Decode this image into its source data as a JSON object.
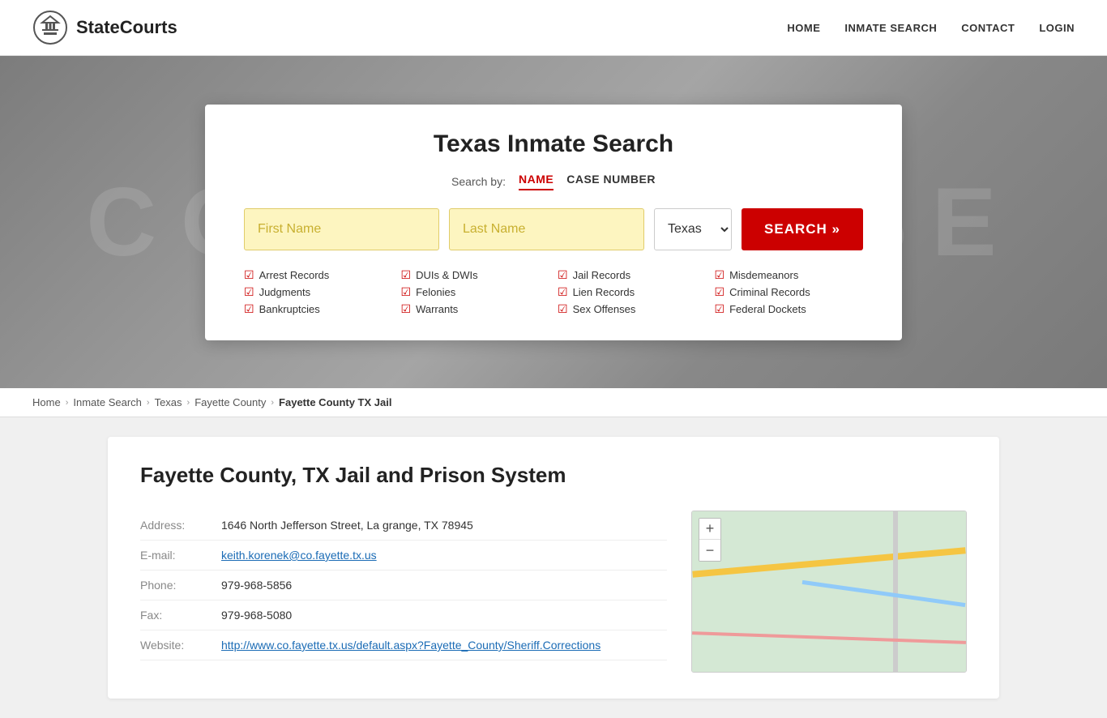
{
  "header": {
    "logo_text": "StateCourts",
    "nav": {
      "home": "HOME",
      "inmate_search": "INMATE SEARCH",
      "contact": "CONTACT",
      "login": "LOGIN"
    }
  },
  "hero": {
    "bg_text": "COURTHOUSE"
  },
  "search_card": {
    "title": "Texas Inmate Search",
    "search_by_label": "Search by:",
    "tab_name": "NAME",
    "tab_case_number": "CASE NUMBER",
    "first_name_placeholder": "First Name",
    "last_name_placeholder": "Last Name",
    "state_value": "Texas",
    "search_button": "SEARCH »",
    "checkboxes": [
      {
        "label": "Arrest Records"
      },
      {
        "label": "DUIs & DWIs"
      },
      {
        "label": "Jail Records"
      },
      {
        "label": "Misdemeanors"
      },
      {
        "label": "Judgments"
      },
      {
        "label": "Felonies"
      },
      {
        "label": "Lien Records"
      },
      {
        "label": "Criminal Records"
      },
      {
        "label": "Bankruptcies"
      },
      {
        "label": "Warrants"
      },
      {
        "label": "Sex Offenses"
      },
      {
        "label": "Federal Dockets"
      }
    ]
  },
  "breadcrumb": {
    "items": [
      {
        "label": "Home",
        "link": true
      },
      {
        "label": "Inmate Search",
        "link": true
      },
      {
        "label": "Texas",
        "link": true
      },
      {
        "label": "Fayette County",
        "link": true
      },
      {
        "label": "Fayette County TX Jail",
        "link": false
      }
    ]
  },
  "content": {
    "title": "Fayette County, TX Jail and Prison System",
    "address_label": "Address:",
    "address_value": "1646 North Jefferson Street, La grange, TX 78945",
    "email_label": "E-mail:",
    "email_value": "keith.korenek@co.fayette.tx.us",
    "phone_label": "Phone:",
    "phone_value": "979-968-5856",
    "fax_label": "Fax:",
    "fax_value": "979-968-5080",
    "website_label": "Website:",
    "website_value": "http://www.co.fayette.tx.us/default.aspx?Fayette_County/Sheriff.Corrections"
  },
  "map": {
    "zoom_in": "+",
    "zoom_out": "−"
  }
}
